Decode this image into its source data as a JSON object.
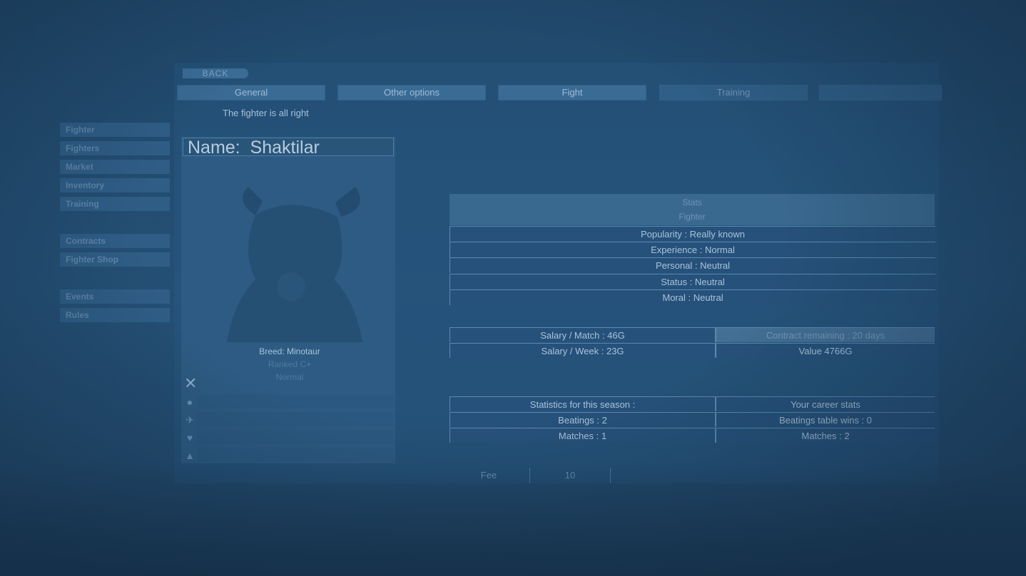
{
  "nav": {
    "back_label": "BACK"
  },
  "tabs": [
    {
      "label": "General"
    },
    {
      "label": "Other options"
    },
    {
      "label": "Fight"
    },
    {
      "label": "Training"
    },
    {
      "label": ""
    }
  ],
  "status_message": "The fighter is all right",
  "sidebar": {
    "items": [
      {
        "label": "Fighter"
      },
      {
        "label": "Fighters"
      },
      {
        "label": "Market"
      },
      {
        "label": "Inventory"
      },
      {
        "label": "Training"
      },
      {
        "label": "Contracts"
      },
      {
        "label": "Fighter Shop"
      },
      {
        "label": "Events"
      },
      {
        "label": "Rules"
      }
    ]
  },
  "fighter": {
    "name_label": "Name:",
    "name": "Shaktilar",
    "breed_label": "Breed:",
    "breed": "Minotaur",
    "sub_line": "Ranked C+",
    "sub_line2": "Normal"
  },
  "stats": {
    "header_top": "Stats",
    "header_sub": "Fighter",
    "rows": [
      {
        "label": "Popularity :",
        "value": "Really known"
      },
      {
        "label": "Experience :",
        "value": "Normal"
      },
      {
        "label": "Personal :",
        "value": "Neutral"
      },
      {
        "label": "Status :",
        "value": "Neutral"
      },
      {
        "label": "Moral :",
        "value": "Neutral"
      }
    ]
  },
  "money": {
    "salary_match": "Salary / Match : 46G",
    "salary_week": "Salary / Week : 23G",
    "contract": "Contract remaining : 20 days",
    "value": "Value 4766G"
  },
  "season": {
    "left_header": "Statistics for this season :",
    "right_header": "Your career stats",
    "left_rows": [
      "Beatings : 2",
      "Matches : 1"
    ],
    "right_rows": [
      "Beatings table wins : 0",
      "Matches : 2"
    ]
  },
  "bottom": {
    "label": "Fee",
    "value": "10"
  },
  "colors": {
    "background": "#21496c",
    "panel": "#2d5b83",
    "text": "#a9c3da",
    "border": "#5b8ab2"
  },
  "icons": [
    "close-icon",
    "shield-icon",
    "sword-icon",
    "heart-icon",
    "boot-icon"
  ]
}
